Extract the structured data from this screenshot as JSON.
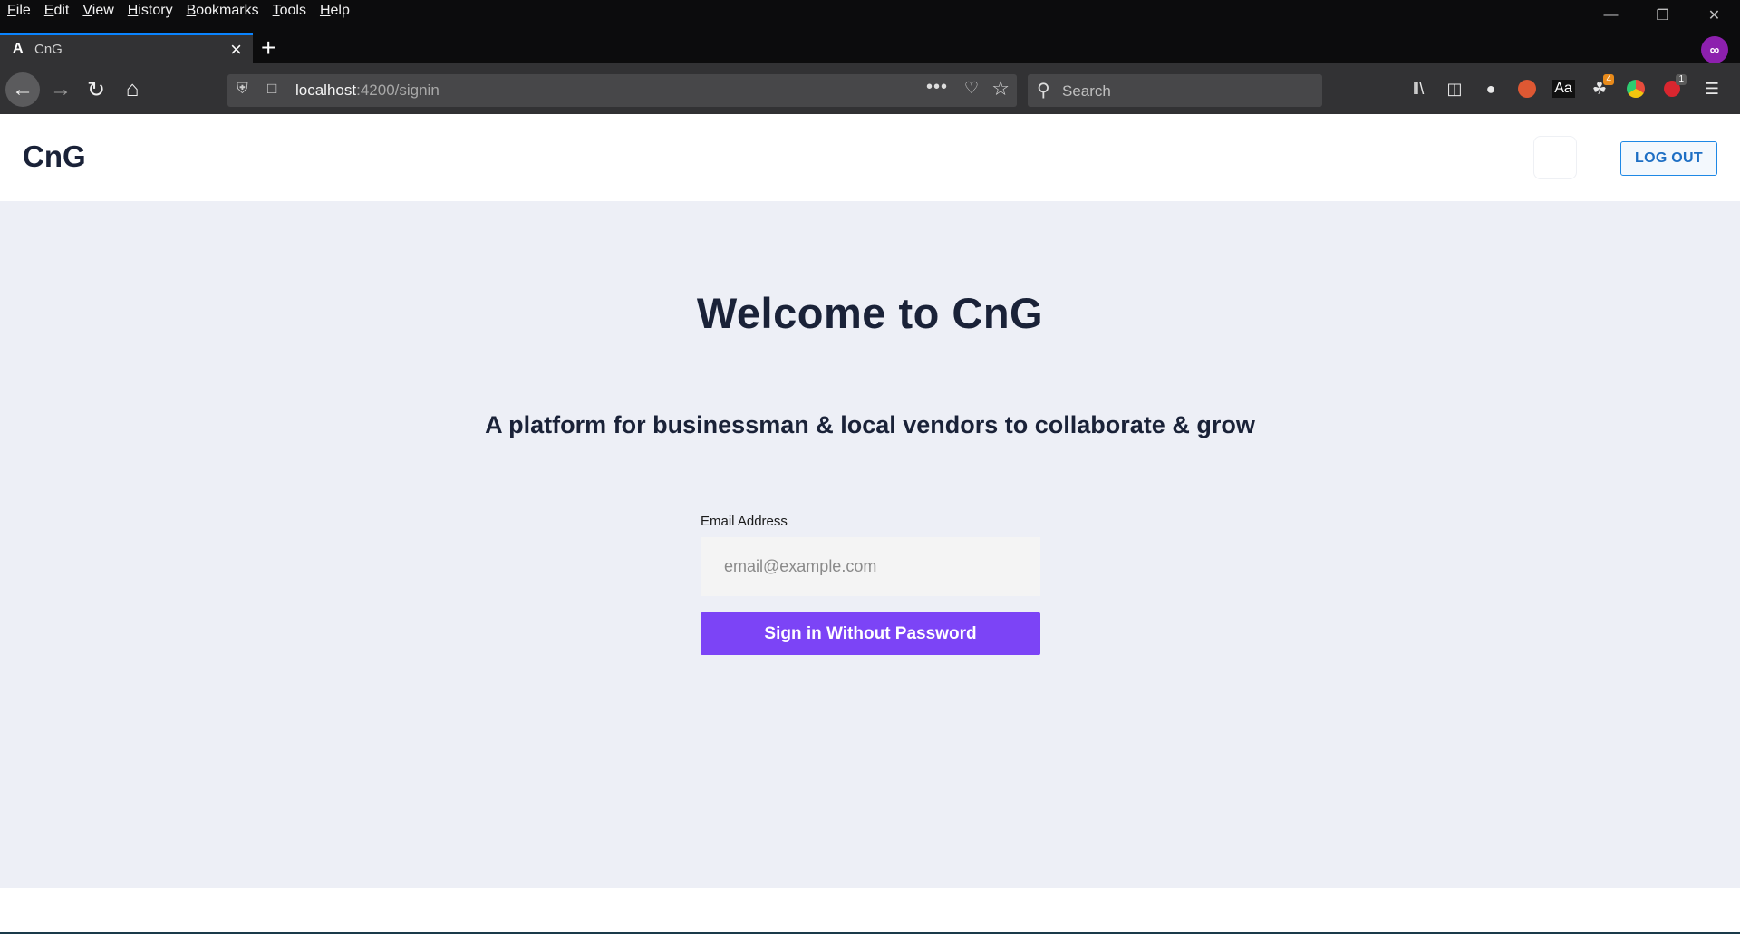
{
  "browser": {
    "menus": [
      "File",
      "Edit",
      "View",
      "History",
      "Bookmarks",
      "Tools",
      "Help"
    ],
    "tab": {
      "favicon": "A",
      "title": "CnG"
    },
    "url": {
      "host": "localhost",
      "rest": ":4200/signin"
    },
    "search_placeholder": "Search",
    "icons": {
      "back": "arrow-left-icon",
      "forward": "arrow-right-icon",
      "reload": "reload-icon",
      "home": "home-icon",
      "library": "library-icon",
      "sidebar": "sidebar-icon",
      "account": "account-icon",
      "duckduckgo": "duck-icon",
      "dictionary": "dictionary-icon",
      "extension_badge": "4",
      "ublock_badge": "1"
    },
    "private_badge": "∞"
  },
  "header": {
    "logo": "CnG",
    "logout_label": "LOG OUT"
  },
  "main": {
    "title": "Welcome to CnG",
    "tagline": "A platform for businessman & local vendors to collaborate & grow",
    "form": {
      "email_label": "Email Address",
      "email_placeholder": "email@example.com",
      "email_value": "",
      "submit_label": "Sign in Without Password"
    }
  },
  "colors": {
    "primary_button": "#7c44f6",
    "logout_border": "#1e88e5",
    "text_dark": "#1a2238",
    "page_bg": "#edeff6"
  }
}
